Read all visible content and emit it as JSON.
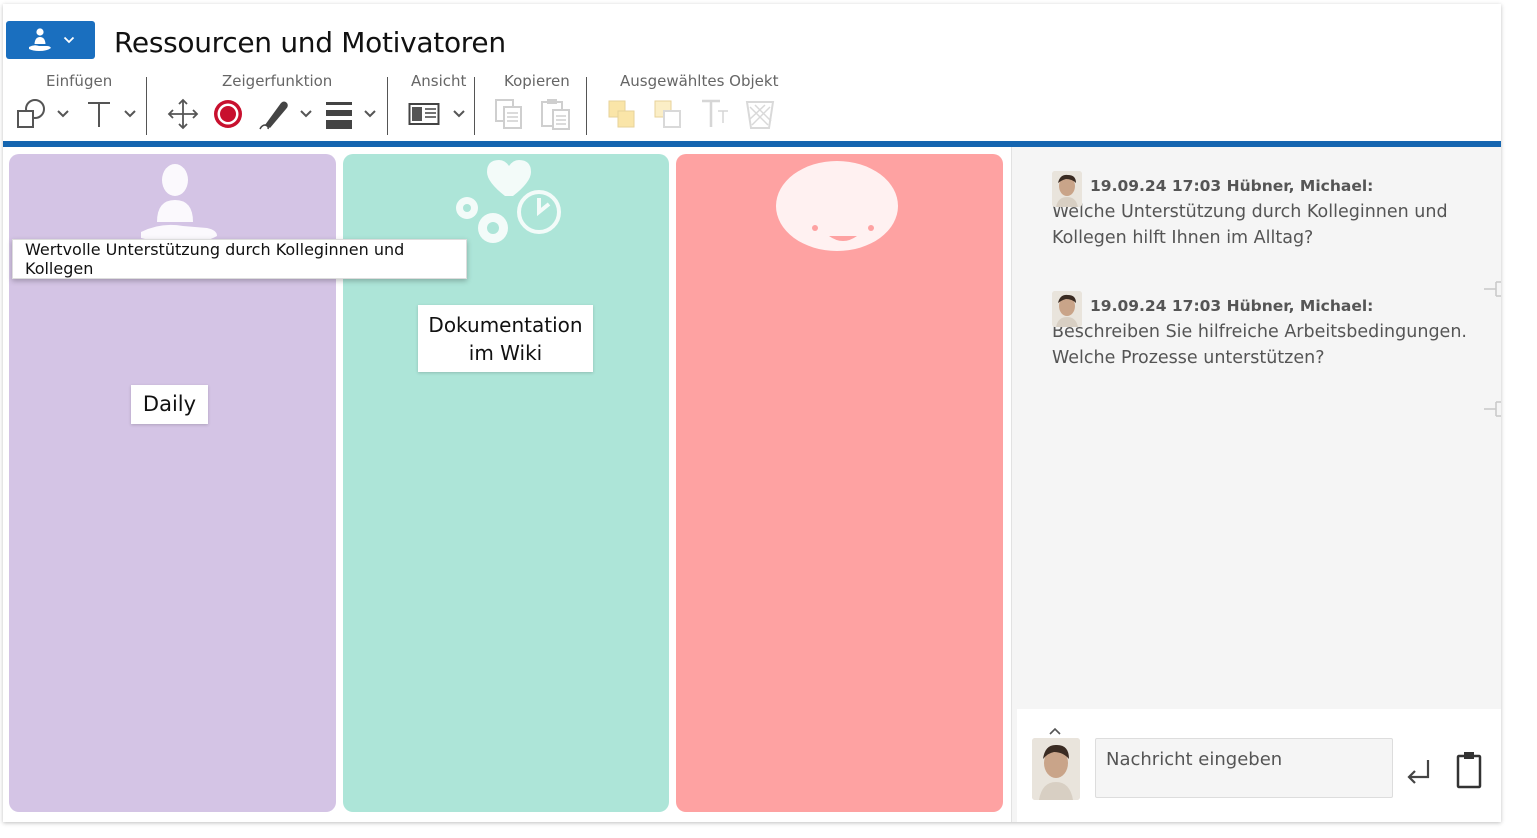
{
  "window": {
    "title": "Ressourcen und Motivatoren"
  },
  "toolbar": {
    "groups": [
      {
        "label": "Einfügen"
      },
      {
        "label": "Zeigerfunktion"
      },
      {
        "label": "Ansicht"
      },
      {
        "label": "Kopieren"
      },
      {
        "label": "Ausgewähltes Objekt"
      }
    ]
  },
  "board": {
    "columns": [
      {
        "color": "#d4c4e5",
        "icon": "person-support-icon"
      },
      {
        "color": "#ade5d8",
        "icon": "gears-heart-clock-icon"
      },
      {
        "color": "#fea2a2",
        "icon": "smiley-icon"
      }
    ],
    "tooltip": "Wertvolle Unterstützung durch Kolleginnen und Kollegen",
    "notes": [
      {
        "text": "Daily"
      },
      {
        "line1": "Dokumentation",
        "line2": "im Wiki"
      }
    ]
  },
  "chat": {
    "messages": [
      {
        "header": "19.09.24 17:03 Hübner, Michael:",
        "line1": "Welche Unterstützung durch Kolleginnen und",
        "line2": "Kollegen hilft Ihnen im Alltag?"
      },
      {
        "header": "19.09.24 17:03 Hübner, Michael:",
        "line1": "Beschreiben Sie hilfreiche Arbeitsbedingungen.",
        "line2": "Welche Prozesse unterstützen?"
      }
    ],
    "input_placeholder": "Nachricht eingeben"
  },
  "colors": {
    "accent": "#1565b0",
    "record": "#c8102e"
  }
}
